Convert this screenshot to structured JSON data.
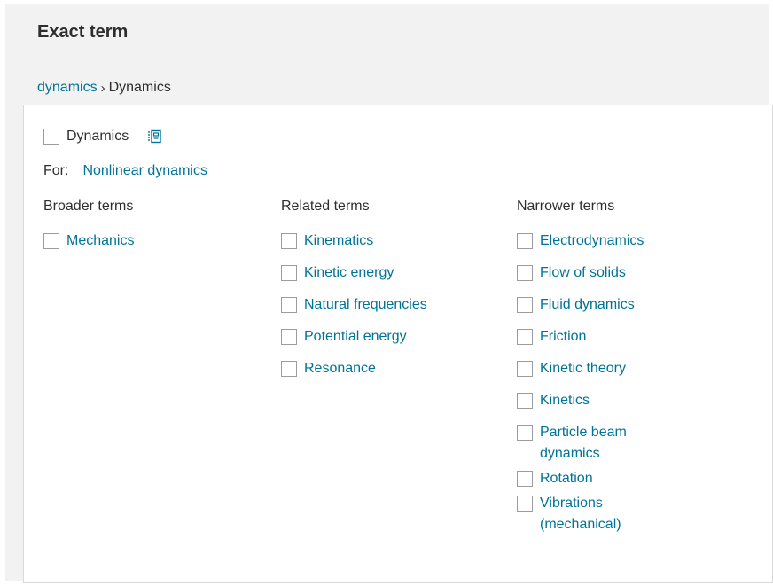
{
  "heading": "Exact term",
  "breadcrumb": {
    "parent": "dynamics",
    "separator": "›",
    "current": "Dynamics"
  },
  "main_term": {
    "label": "Dynamics",
    "icon": "list-detail-icon"
  },
  "for": {
    "label": "For:",
    "value": "Nonlinear dynamics"
  },
  "columns": {
    "broader": {
      "title": "Broader terms",
      "items": [
        "Mechanics"
      ]
    },
    "related": {
      "title": "Related terms",
      "items": [
        "Kinematics",
        "Kinetic energy",
        "Natural frequencies",
        "Potential energy",
        "Resonance"
      ]
    },
    "narrower": {
      "title": "Narrower terms",
      "items": [
        "Electrodynamics",
        "Flow of solids",
        "Fluid dynamics",
        "Friction",
        "Kinetic theory",
        "Kinetics",
        "Particle beam dynamics",
        "Rotation",
        "Vibrations (mechanical)"
      ]
    }
  },
  "colors": {
    "link": "#007398",
    "text": "#2e2e2e",
    "panel_bg": "#f2f2f2",
    "checkbox_border": "#9c9c9c"
  }
}
